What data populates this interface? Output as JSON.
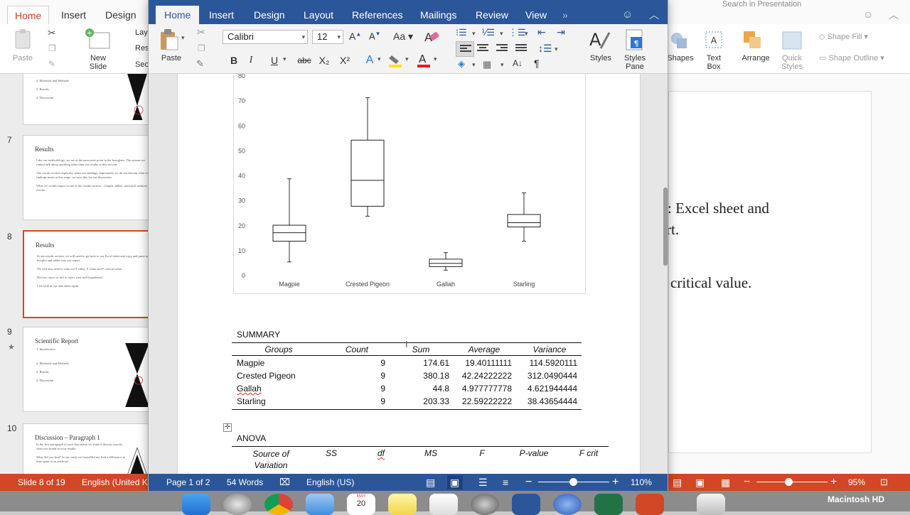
{
  "powerpoint": {
    "tabs": [
      "Home",
      "Insert",
      "Design"
    ],
    "search_placeholder": "Search in Presentation",
    "ribbon": {
      "paste": "Paste",
      "new_slide": "New Slide",
      "layout": "Lay",
      "reset": "Res",
      "section": "Sec",
      "shapes": "Shapes",
      "text_box": "Text Box",
      "arrange": "Arrange",
      "quick_styles": "Quick Styles",
      "shape_fill": "Shape Fill",
      "shape_outline": "Shape Outline"
    },
    "thumbnails": [
      {
        "number": "",
        "title": "",
        "bullets": [
          "2.  Materials and Methods",
          "3.  Results",
          "4.  Discussion"
        ]
      },
      {
        "number": "7",
        "title": "Results",
        "bullets": [
          "Like our methodology, we are at the narrowest point in the hourglass. This means we cannot talk about anything other than our results in this section.",
          "The results section explicitly states our findings, importantly we do not discuss what our findings mean at this stage, we save this for our discussion.",
          "What we would expect to see in the results section – Graphs, tables, statistical analysis results."
        ]
      },
      {
        "number": "8",
        "title": "Results",
        "bullets": [
          "In our results section, we will need to go back to our Excel sheet and copy and paste our boxplot and tables into our report.",
          "We will also need to state our P value, F value and F critical value.",
          "Did you reject or fail to reject your null hypothesis?",
          "Lets look at our data sheet again."
        ]
      },
      {
        "number": "9",
        "title": "Scientific Report",
        "bullets": [
          "1.  Introduction",
          "2.  Materials and Methods",
          "3.  Results",
          "4.  Discussion"
        ]
      },
      {
        "number": "10",
        "title": "Discussion – Paragraph 1",
        "bullets": [
          "In the first paragraph of your discussion we want to discuss exactly what you found in your results.",
          "What did you find? In our study we found/did not find a difference in time spent at an artificial"
        ]
      }
    ],
    "slide_text": [
      ": Excel sheet and",
      "rt.",
      "critical value."
    ],
    "status": {
      "slide": "Slide 8 of 19",
      "language": "English (United K",
      "zoom": "95%"
    }
  },
  "word": {
    "tabs": [
      "Home",
      "Insert",
      "Design",
      "Layout",
      "References",
      "Mailings",
      "Review",
      "View"
    ],
    "more_tabs": "»",
    "ribbon": {
      "paste": "Paste",
      "font_name": "Calibri",
      "font_size": "12",
      "bold": "B",
      "italic": "I",
      "underline": "U",
      "strike": "abc",
      "subscript": "X₂",
      "superscript": "X²",
      "styles": "Styles",
      "styles_pane": "Styles Pane"
    },
    "status": {
      "page": "Page 1 of 2",
      "words": "54 Words",
      "language": "English (US)",
      "zoom": "110%"
    }
  },
  "chart_data": {
    "type": "boxplot",
    "categories": [
      "Magpie",
      "Crested Pigeon",
      "Gallah",
      "Starling"
    ],
    "ylim": [
      0,
      80
    ],
    "yticks": [
      0,
      10,
      20,
      30,
      40,
      50,
      60,
      70,
      80
    ],
    "boxes": [
      {
        "name": "Magpie",
        "min": 5.5,
        "q1": 13.8,
        "median": 17.2,
        "q3": 20.2,
        "max": 38.8
      },
      {
        "name": "Crested Pigeon",
        "min": 23.8,
        "q1": 27.8,
        "median": 38.2,
        "q3": 54.3,
        "max": 71.3
      },
      {
        "name": "Gallah",
        "min": 2.2,
        "q1": 3.6,
        "median": 4.9,
        "q3": 6.6,
        "max": 9.2
      },
      {
        "name": "Starling",
        "min": 13.8,
        "q1": 19.5,
        "median": 21.2,
        "q3": 24.5,
        "max": 33.2
      }
    ],
    "grid": false,
    "legend": "none"
  },
  "summary": {
    "title": "SUMMARY",
    "headers": [
      "Groups",
      "Count",
      "Sum",
      "Average",
      "Variance"
    ],
    "rows": [
      [
        "Magpie",
        "9",
        "174.61",
        "19.40111111",
        "114.5920111"
      ],
      [
        "Crested Pigeon",
        "9",
        "380.18",
        "42.24222222",
        "312.0490444"
      ],
      [
        "Gallah",
        "9",
        "44.8",
        "4.977777778",
        "4.621944444"
      ],
      [
        "Starling",
        "9",
        "203.33",
        "22.59222222",
        "38.43654444"
      ]
    ]
  },
  "anova": {
    "title": "ANOVA",
    "headers": [
      "Source of Variation",
      "SS",
      "df",
      "MS",
      "F",
      "P-value",
      "F crit"
    ]
  },
  "dock": {
    "calendar_month": "MAY",
    "calendar_day": "20",
    "drive_label": "Macintosh HD"
  }
}
